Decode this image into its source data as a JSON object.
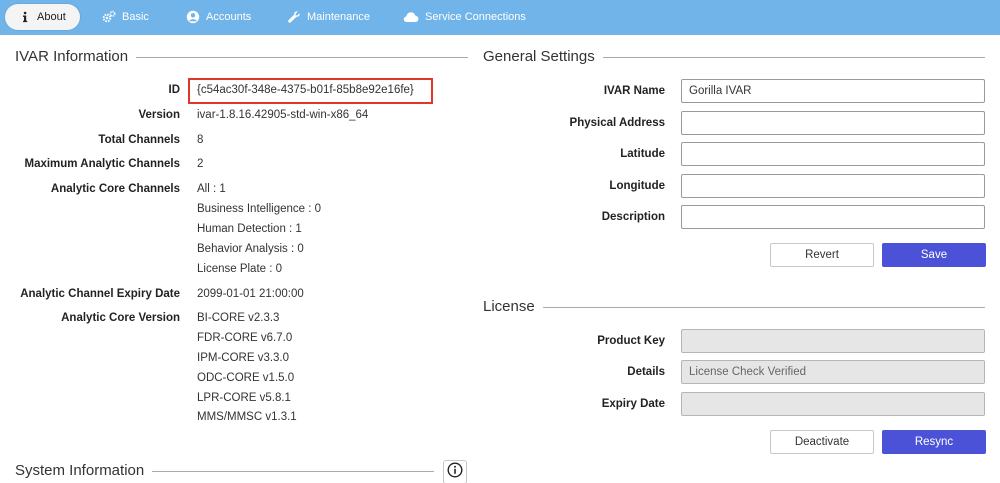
{
  "nav": {
    "tabs": [
      {
        "label": "About",
        "icon": "info-icon",
        "active": true
      },
      {
        "label": "Basic",
        "icon": "gears-icon"
      },
      {
        "label": "Accounts",
        "icon": "user-icon"
      },
      {
        "label": "Maintenance",
        "icon": "wrench-icon"
      },
      {
        "label": "Service Connections",
        "icon": "cloud-icon"
      }
    ]
  },
  "ivar_info": {
    "title": "IVAR Information",
    "id_label": "ID",
    "id_value": "{c54ac30f-348e-4375-b01f-85b8e92e16fe}",
    "version_label": "Version",
    "version_value": "ivar-1.8.16.42905-std-win-x86_64",
    "total_channels_label": "Total Channels",
    "total_channels_value": "8",
    "max_analytic_label": "Maximum Analytic Channels",
    "max_analytic_value": "2",
    "core_channels_label": "Analytic Core Channels",
    "core_channels": [
      "All : 1",
      "Business Intelligence : 0",
      "Human Detection : 1",
      "Behavior Analysis : 0",
      "License Plate : 0"
    ],
    "expiry_label": "Analytic Channel Expiry Date",
    "expiry_value": "2099-01-01 21:00:00",
    "core_version_label": "Analytic Core Version",
    "core_versions": [
      "BI-CORE v2.3.3",
      "FDR-CORE v6.7.0",
      "IPM-CORE v3.3.0",
      "ODC-CORE v1.5.0",
      "LPR-CORE v5.8.1",
      "MMS/MMSC v1.3.1"
    ]
  },
  "system_info": {
    "title": "System Information"
  },
  "general_settings": {
    "title": "General Settings",
    "ivar_name_label": "IVAR Name",
    "ivar_name_value": "Gorilla IVAR",
    "physical_address_label": "Physical Address",
    "physical_address_value": "",
    "latitude_label": "Latitude",
    "latitude_value": "",
    "longitude_label": "Longitude",
    "longitude_value": "",
    "description_label": "Description",
    "description_value": "",
    "revert_label": "Revert",
    "save_label": "Save"
  },
  "license": {
    "title": "License",
    "product_key_label": "Product Key",
    "product_key_value": "",
    "details_label": "Details",
    "details_value": "License Check Verified",
    "expiry_label": "Expiry Date",
    "expiry_value": "",
    "deactivate_label": "Deactivate",
    "resync_label": "Resync"
  },
  "colors": {
    "topbar": "#70b4ea",
    "primary_button": "#4b52d8",
    "highlight_box": "#e2362b"
  }
}
